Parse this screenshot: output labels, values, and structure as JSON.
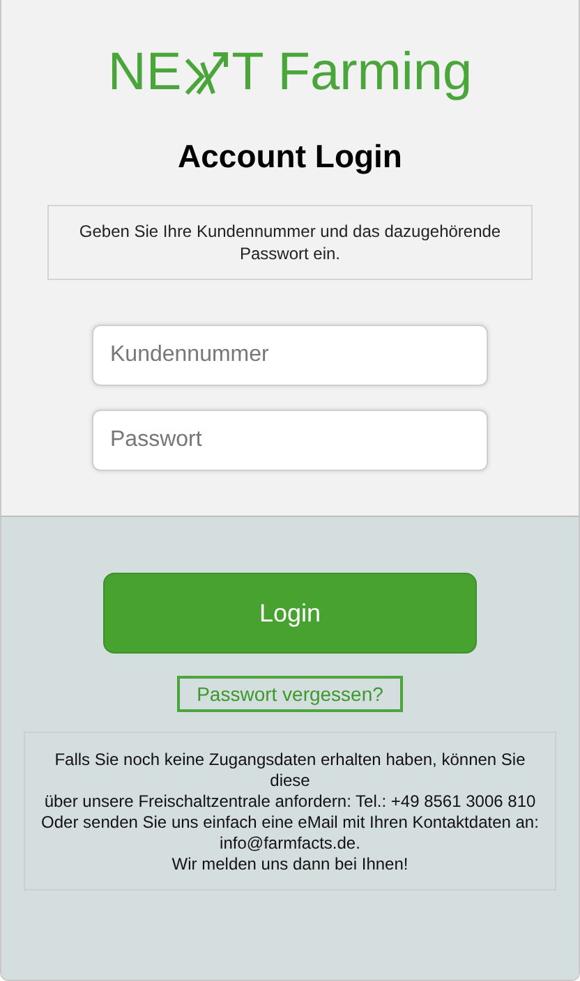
{
  "logo": {
    "before": "NE",
    "after": "T Farming"
  },
  "title": "Account Login",
  "instructions": "Geben Sie Ihre Kundennummer und das dazugehörende Passwort ein.",
  "fields": [
    {
      "placeholder": "Kundennummer"
    },
    {
      "placeholder": "Passwort"
    }
  ],
  "login_button": "Login",
  "forgot_link": "Passwort vergessen?",
  "info_lines": [
    "Falls Sie noch keine Zugangsdaten erhalten haben, können Sie",
    "diese",
    "über unsere Freischaltzentrale anfordern: Tel.: +49 8561 3006 810",
    "Oder senden Sie uns einfach eine eMail mit Ihren Kontaktdaten an:",
    "info@farmfacts.de.",
    "Wir melden uns dann bei Ihnen!"
  ]
}
